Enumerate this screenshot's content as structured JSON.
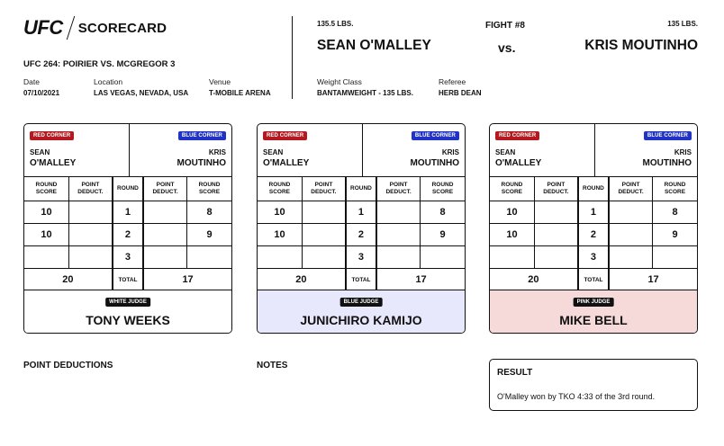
{
  "header": {
    "logo_ufc": "UFC",
    "logo_scorecard": "SCORECARD",
    "event": "UFC 264: POIRIER VS. MCGREGOR 3",
    "labels": {
      "date": "Date",
      "location": "Location",
      "venue": "Venue",
      "weight_class": "Weight Class",
      "referee": "Referee"
    },
    "date": "07/10/2021",
    "location": "LAS VEGAS, NEVADA, USA",
    "venue": "T-MOBILE ARENA",
    "weight_class": "BANTAMWEIGHT - 135 LBS.",
    "referee": "HERB DEAN"
  },
  "fight": {
    "number": "FIGHT #8",
    "vs": "vs.",
    "red": {
      "weight": "135.5 LBS.",
      "name": "SEAN O'MALLEY"
    },
    "blue": {
      "weight": "135 LBS.",
      "name": "KRIS MOUTINHO"
    }
  },
  "card_labels": {
    "red_corner": "RED CORNER",
    "blue_corner": "BLUE CORNER",
    "round_score": "ROUND SCORE",
    "point_deduct": "POINT DEDUCT.",
    "round": "ROUND",
    "total": "TOTAL"
  },
  "fighters": {
    "red_first": "SEAN",
    "red_last": "O'MALLEY",
    "blue_first": "KRIS",
    "blue_last": "MOUTINHO"
  },
  "scorecards": [
    {
      "judge_badge": "WHITE JUDGE",
      "judge_name": "TONY WEEKS",
      "rounds": [
        {
          "round": "1",
          "red": "10",
          "red_ded": "",
          "blue_ded": "",
          "blue": "8"
        },
        {
          "round": "2",
          "red": "10",
          "red_ded": "",
          "blue_ded": "",
          "blue": "9"
        },
        {
          "round": "3",
          "red": "",
          "red_ded": "",
          "blue_ded": "",
          "blue": ""
        }
      ],
      "total_red": "20",
      "total_blue": "17"
    },
    {
      "judge_badge": "BLUE JUDGE",
      "judge_name": "JUNICHIRO KAMIJO",
      "rounds": [
        {
          "round": "1",
          "red": "10",
          "red_ded": "",
          "blue_ded": "",
          "blue": "8"
        },
        {
          "round": "2",
          "red": "10",
          "red_ded": "",
          "blue_ded": "",
          "blue": "9"
        },
        {
          "round": "3",
          "red": "",
          "red_ded": "",
          "blue_ded": "",
          "blue": ""
        }
      ],
      "total_red": "20",
      "total_blue": "17"
    },
    {
      "judge_badge": "PINK JUDGE",
      "judge_name": "MIKE BELL",
      "rounds": [
        {
          "round": "1",
          "red": "10",
          "red_ded": "",
          "blue_ded": "",
          "blue": "8"
        },
        {
          "round": "2",
          "red": "10",
          "red_ded": "",
          "blue_ded": "",
          "blue": "9"
        },
        {
          "round": "3",
          "red": "",
          "red_ded": "",
          "blue_ded": "",
          "blue": ""
        }
      ],
      "total_red": "20",
      "total_blue": "17"
    }
  ],
  "bottom": {
    "point_deductions": "POINT DEDUCTIONS",
    "notes": "NOTES",
    "result_label": "RESULT",
    "result_text": "O'Malley won by TKO 4:33 of the 3rd round."
  },
  "colors": {
    "red_corner": "#b3191e",
    "blue_corner": "#2033c5",
    "blue_judge_bg": "#e7e8fc",
    "pink_judge_bg": "#f6d9d9"
  }
}
